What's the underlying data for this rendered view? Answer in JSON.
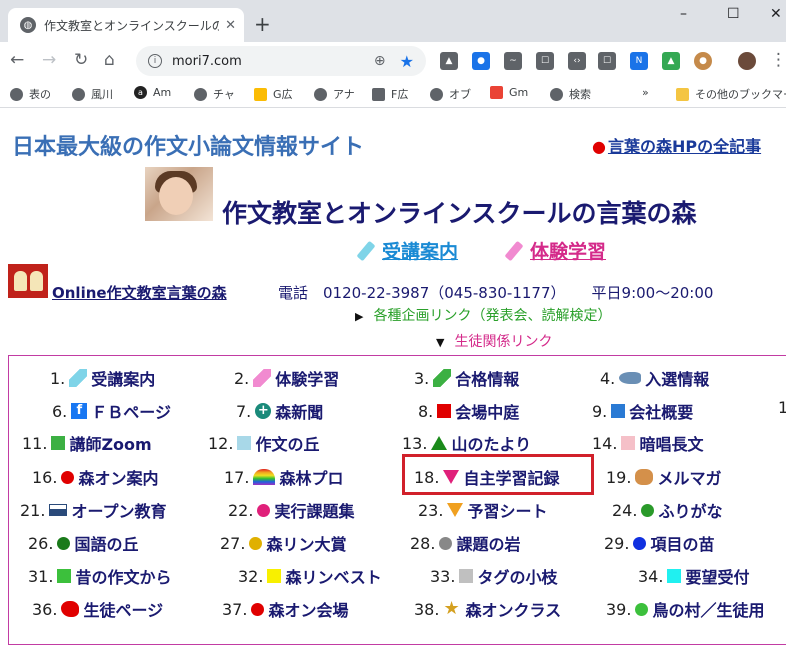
{
  "browser": {
    "tab_title": "作文教室とオンラインスクールの言葉の森",
    "url": "mori7.com",
    "window_controls": [
      "–",
      "☐",
      "✕"
    ],
    "bookmarks": [
      {
        "label": "表の",
        "icon": "globe-icon"
      },
      {
        "label": "風川",
        "icon": "globe-icon"
      },
      {
        "label": "Am",
        "icon": "amazon-icon"
      },
      {
        "label": "チャ",
        "icon": "globe-icon"
      },
      {
        "label": "G広",
        "icon": "google-ads-icon"
      },
      {
        "label": "アナ",
        "icon": "globe-icon"
      },
      {
        "label": "F広",
        "icon": "document-icon"
      },
      {
        "label": "オブ",
        "icon": "globe-icon"
      },
      {
        "label": "Gm",
        "icon": "gmail-icon"
      },
      {
        "label": "検索",
        "icon": "globe-icon"
      },
      {
        "label": "その他のブックマーク",
        "icon": "folder-icon"
      }
    ]
  },
  "page": {
    "site_heading": "日本最大級の作文小論文情報サイト",
    "all_posts_link": "言葉の森HPの全記事",
    "main_title": "作文教室とオンラインスクールの言葉の森",
    "cta_course": "受講案内",
    "cta_trial": "体験学習",
    "online_link": "Online作文教室言葉の森",
    "phone": "電話　0120-22-3987（045-830-1177）",
    "hours": "平日9:00～20:00",
    "events_link": "各種企画リンク（発表会、読解検定）",
    "students_link": "生徒関係リンク"
  },
  "links": [
    {
      "num": "1.",
      "label": "受講案内",
      "icon": "pencil-icon",
      "color": "#7fd4e8"
    },
    {
      "num": "2.",
      "label": "体験学習",
      "icon": "pencil-icon",
      "color": "#f18ad0"
    },
    {
      "num": "3.",
      "label": "合格情報",
      "icon": "pencil-icon",
      "color": "#3cb043"
    },
    {
      "num": "4.",
      "label": "入選情報",
      "icon": "fish-icon",
      "color": "#6a8fb5"
    },
    {
      "num": "6.",
      "label": "ＦＢページ",
      "icon": "facebook-icon",
      "color": "#1877f2"
    },
    {
      "num": "7.",
      "label": "森新聞",
      "icon": "globe-icon",
      "color": "#1a8a7a"
    },
    {
      "num": "8.",
      "label": "会場中庭",
      "icon": "square-icon",
      "color": "#e00000"
    },
    {
      "num": "9.",
      "label": "会社概要",
      "icon": "square-icon",
      "color": "#2a7ad4"
    },
    {
      "num": "11.",
      "label": "講師Zoom",
      "icon": "square-icon",
      "color": "#3cb043"
    },
    {
      "num": "12.",
      "label": "作文の丘",
      "icon": "square-icon",
      "color": "#a8d8e8"
    },
    {
      "num": "13.",
      "label": "山のたより",
      "icon": "triangle-up-icon",
      "color": "#1a8a1a"
    },
    {
      "num": "14.",
      "label": "暗唱長文",
      "icon": "square-icon",
      "color": "#f5c0c8"
    },
    {
      "num": "16.",
      "label": "森オン案内",
      "icon": "circle-icon",
      "color": "#e00000"
    },
    {
      "num": "17.",
      "label": "森林プロ",
      "icon": "rainbow-icon",
      "color": "#e86fb0"
    },
    {
      "num": "18.",
      "label": "自主学習記録",
      "icon": "triangle-down-icon",
      "color": "#e0207a"
    },
    {
      "num": "19.",
      "label": "メルマガ",
      "icon": "animal-icon",
      "color": "#d4904a"
    },
    {
      "num": "21.",
      "label": "オープン教育",
      "icon": "ship-icon",
      "color": "#2a4a7a"
    },
    {
      "num": "22.",
      "label": "実行課題集",
      "icon": "circle-icon",
      "color": "#e0207a"
    },
    {
      "num": "23.",
      "label": "予習シート",
      "icon": "triangle-down-icon",
      "color": "#f0a020"
    },
    {
      "num": "24.",
      "label": "ふりがな",
      "icon": "circle-icon",
      "color": "#2a9a2a"
    },
    {
      "num": "26.",
      "label": "国語の丘",
      "icon": "circle-icon",
      "color": "#1a7a1a"
    },
    {
      "num": "27.",
      "label": "森リン大賞",
      "icon": "circle-icon",
      "color": "#e0b000"
    },
    {
      "num": "28.",
      "label": "課題の岩",
      "icon": "circle-icon",
      "color": "#888888"
    },
    {
      "num": "29.",
      "label": "項目の苗",
      "icon": "circle-icon",
      "color": "#1030e0"
    },
    {
      "num": "31.",
      "label": "昔の作文から",
      "icon": "square-icon",
      "color": "#3cc03c"
    },
    {
      "num": "32.",
      "label": "森リンベスト",
      "icon": "square-icon",
      "color": "#f8f000"
    },
    {
      "num": "33.",
      "label": "タグの小枝",
      "icon": "square-icon",
      "color": "#c0c0c0"
    },
    {
      "num": "34.",
      "label": "要望受付",
      "icon": "square-icon",
      "color": "#20f0f0"
    },
    {
      "num": "36.",
      "label": "生徒ページ",
      "icon": "bird-icon",
      "color": "#e00000"
    },
    {
      "num": "37.",
      "label": "森オン会場",
      "icon": "circle-icon",
      "color": "#e00000"
    },
    {
      "num": "38.",
      "label": "森オンクラス",
      "icon": "star-icon",
      "color": "#d4a020"
    },
    {
      "num": "39.",
      "label": "鳥の村／生徒用",
      "icon": "circle-icon",
      "color": "#3cc03c"
    }
  ],
  "extra_number": "1"
}
